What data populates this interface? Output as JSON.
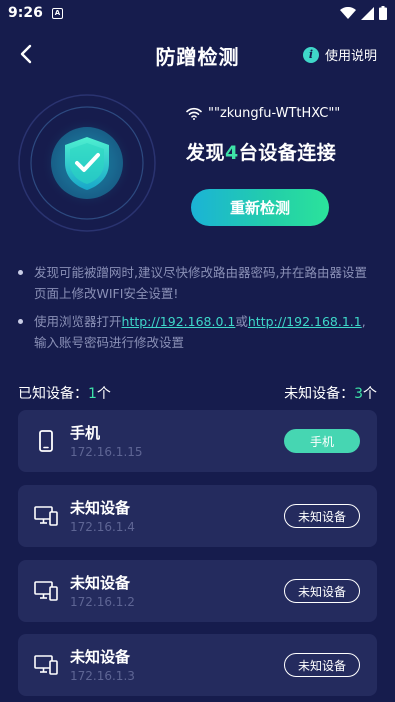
{
  "status_bar": {
    "time": "9:26",
    "app_icon_letter": "A"
  },
  "header": {
    "title": "防蹭检测",
    "help_label": "使用说明"
  },
  "hero": {
    "ssid": "\"\"zkungfu-WTtHXC\"\"",
    "found_prefix": "发现",
    "found_count": "4",
    "found_suffix": "台设备连接",
    "rescan_label": "重新检测"
  },
  "tips": {
    "tip1": "发现可能被蹭网时,建议尽快修改路由器密码,并在路由器设置页面上修改WIFI安全设置!",
    "tip2_prefix": "使用浏览器打开",
    "tip2_link1": "http://192.168.0.1",
    "tip2_or": "或",
    "tip2_link2": "http://192.168.1.1",
    "tip2_suffix": ",输入账号密码进行修改设置"
  },
  "summary": {
    "known_label": "已知设备：",
    "known_count": "1",
    "known_unit": "个",
    "unknown_label": "未知设备：",
    "unknown_count": "3",
    "unknown_unit": "个"
  },
  "devices": [
    {
      "name": "手机",
      "ip": "172.16.1.15",
      "tag": "手机",
      "icon": "phone-icon"
    },
    {
      "name": "未知设备",
      "ip": "172.16.1.4",
      "tag": "未知设备",
      "icon": "desktop-icon"
    },
    {
      "name": "未知设备",
      "ip": "172.16.1.2",
      "tag": "未知设备",
      "icon": "desktop-icon"
    },
    {
      "name": "未知设备",
      "ip": "172.16.1.3",
      "tag": "未知设备",
      "icon": "desktop-icon"
    }
  ],
  "colors": {
    "background": "#161c4d",
    "card": "#242b5e",
    "accent_green": "#3ee3a8",
    "accent_teal": "#3ed7c9",
    "muted_text": "#8a90b6"
  }
}
